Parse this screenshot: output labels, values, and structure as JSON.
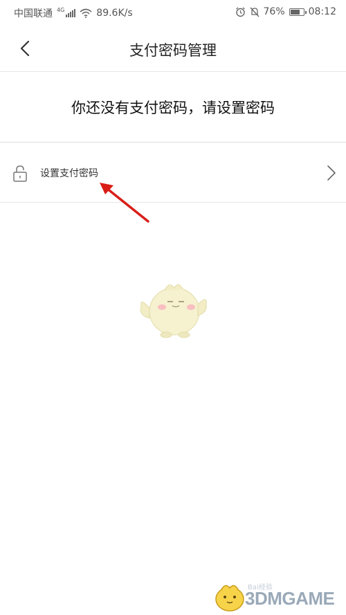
{
  "status_bar": {
    "carrier": "中国联通",
    "network_type": "4G",
    "speed": "89.6K/s",
    "battery": "76%",
    "battery_level": 0.76,
    "time": "08:12",
    "icons": [
      "signal-icon",
      "wifi-icon",
      "alarm-icon",
      "mute-icon",
      "battery-icon"
    ]
  },
  "header": {
    "back_icon": "chevron-left-icon",
    "title": "支付密码管理"
  },
  "notice": {
    "text": "你还没有支付密码，请设置密码"
  },
  "menu": {
    "items": [
      {
        "icon": "lock-icon",
        "label": "设置支付密码",
        "chevron": "chevron-right-icon"
      }
    ]
  },
  "annotation": {
    "arrow_color": "#d91e18"
  },
  "watermark": {
    "brand": "3DMGAME",
    "sub": "Bai经验"
  }
}
